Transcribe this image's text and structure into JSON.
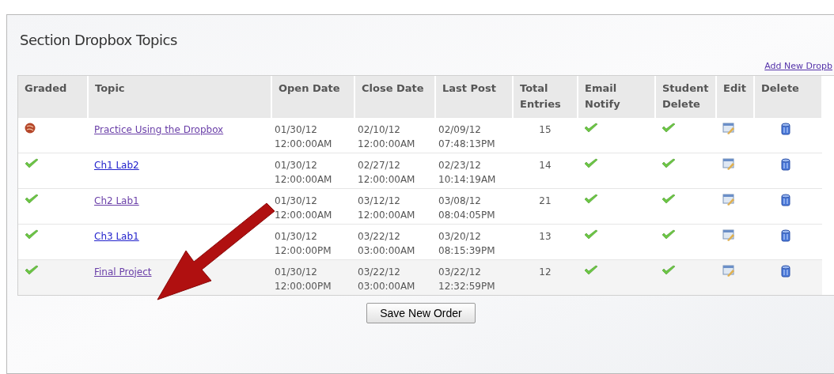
{
  "panel": {
    "title": "Section Dropbox Topics",
    "add_link": "Add New Dropb"
  },
  "table": {
    "columns": [
      "Graded",
      "Topic",
      "Open Date",
      "Close Date",
      "Last Post",
      "Total Entries",
      "Email Notify",
      "Student Delete",
      "Edit",
      "Delete"
    ],
    "rows": [
      {
        "graded": false,
        "topic": "Practice Using the Dropbox",
        "visited": true,
        "open": [
          "01/30/12",
          "12:00:00AM"
        ],
        "close": [
          "02/10/12",
          "12:00:00AM"
        ],
        "last": [
          "02/09/12",
          "07:48:13PM"
        ],
        "entries": "15",
        "email_notify": true,
        "student_delete": true
      },
      {
        "graded": true,
        "topic": "Ch1 Lab2",
        "visited": false,
        "open": [
          "01/30/12",
          "12:00:00AM"
        ],
        "close": [
          "02/27/12",
          "12:00:00AM"
        ],
        "last": [
          "02/23/12",
          "10:14:19AM"
        ],
        "entries": "14",
        "email_notify": true,
        "student_delete": true
      },
      {
        "graded": true,
        "topic": "Ch2 Lab1",
        "visited": true,
        "open": [
          "01/30/12",
          "12:00:00AM"
        ],
        "close": [
          "03/12/12",
          "12:00:00AM"
        ],
        "last": [
          "03/08/12",
          "08:04:05PM"
        ],
        "entries": "21",
        "email_notify": true,
        "student_delete": true
      },
      {
        "graded": true,
        "topic": "Ch3 Lab1",
        "visited": false,
        "open": [
          "01/30/12",
          "12:00:00PM"
        ],
        "close": [
          "03/22/12",
          "03:00:00AM"
        ],
        "last": [
          "03/20/12",
          "08:15:39PM"
        ],
        "entries": "13",
        "email_notify": true,
        "student_delete": true
      },
      {
        "graded": true,
        "topic": "Final Project",
        "visited": true,
        "open": [
          "01/30/12",
          "12:00:00PM"
        ],
        "close": [
          "03/22/12",
          "03:00:00AM"
        ],
        "last": [
          "03/22/12",
          "12:32:59PM"
        ],
        "entries": "12",
        "email_notify": true,
        "student_delete": true
      }
    ]
  },
  "save_button": "Save New Order"
}
